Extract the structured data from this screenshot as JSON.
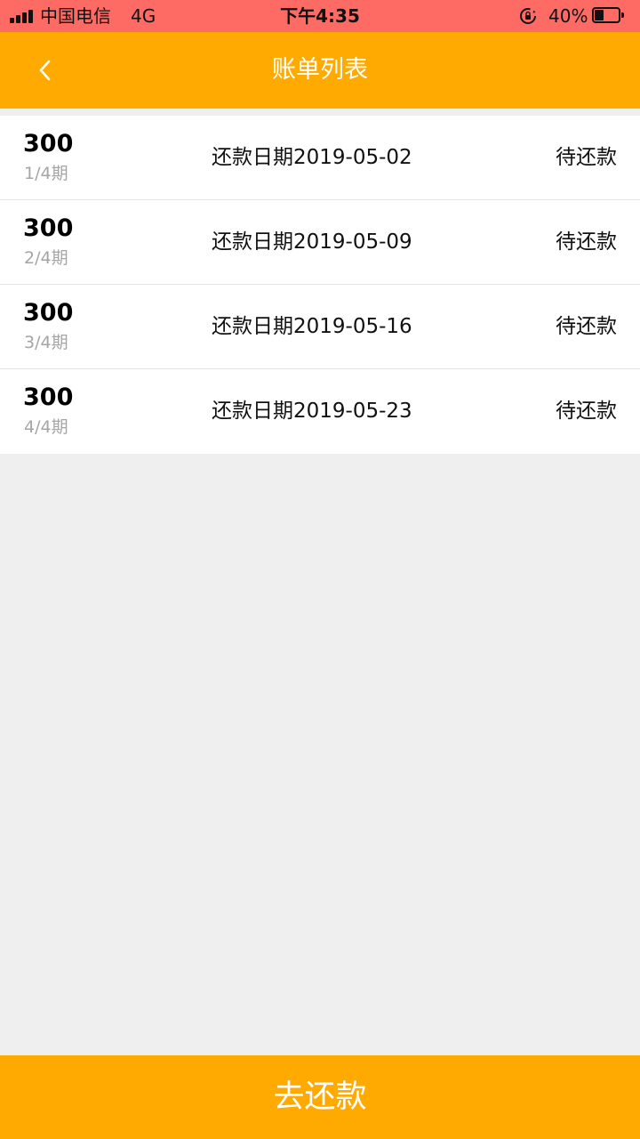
{
  "status_bar": {
    "carrier": "中国电信",
    "network": "4G",
    "time": "下午4:35",
    "battery_percent": "40%",
    "battery_level": 0.4,
    "icons": [
      "signal-icon",
      "rotation-lock-icon",
      "battery-icon"
    ]
  },
  "nav": {
    "back_icon": "chevron-left-icon",
    "title": "账单列表"
  },
  "bills": [
    {
      "amount": "300",
      "period": "1/4期",
      "due": "还款日期2019-05-02",
      "status": "待还款"
    },
    {
      "amount": "300",
      "period": "2/4期",
      "due": "还款日期2019-05-09",
      "status": "待还款"
    },
    {
      "amount": "300",
      "period": "3/4期",
      "due": "还款日期2019-05-16",
      "status": "待还款"
    },
    {
      "amount": "300",
      "period": "4/4期",
      "due": "还款日期2019-05-23",
      "status": "待还款"
    }
  ],
  "footer": {
    "pay_label": "去还款"
  },
  "colors": {
    "status_bar": "#fd6b64",
    "accent": "#ffaa00",
    "page_background": "#efefef"
  }
}
